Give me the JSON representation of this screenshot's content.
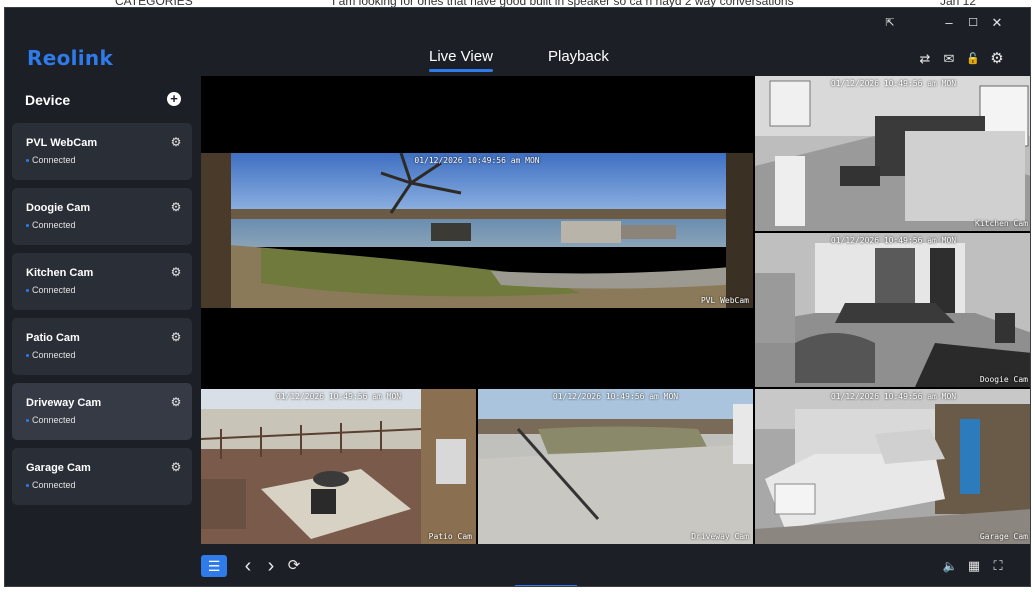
{
  "background_page": {
    "left_text": "CATEGORIES",
    "center_text": "I am looking for ones that have good built in speaker so ca n hayd 2 way conversations",
    "right_text": "Jan 12"
  },
  "app": {
    "logo": "Reolink",
    "accent_color": "#2f7bea"
  },
  "titlebar": {
    "pin_icon": "pin-window-icon",
    "minimize_icon": "minimize-icon",
    "maximize_icon": "maximize-icon",
    "close_icon": "close-icon",
    "pin_glyph": "⇱",
    "minimize_glyph": "–",
    "maximize_glyph": "☐",
    "close_glyph": "✕"
  },
  "nav": {
    "tabs": [
      {
        "label": "Live View",
        "active": true
      },
      {
        "label": "Playback",
        "active": false
      }
    ]
  },
  "header_icons": {
    "switch_glyph": "⇄",
    "message_glyph": "✉",
    "lock_glyph": "🔓",
    "settings_glyph": "⚙"
  },
  "sidebar": {
    "title": "Device",
    "add_glyph": "+",
    "devices": [
      {
        "name": "PVL WebCam",
        "status": "Connected"
      },
      {
        "name": "Doogie Cam",
        "status": "Connected"
      },
      {
        "name": "Kitchen Cam",
        "status": "Connected"
      },
      {
        "name": "Patio Cam",
        "status": "Connected"
      },
      {
        "name": "Driveway Cam",
        "status": "Connected",
        "selected": true
      },
      {
        "name": "Garage Cam",
        "status": "Connected"
      }
    ],
    "gear_glyph": "⚙"
  },
  "grid": {
    "tiles": [
      {
        "label": "PVL WebCam",
        "stamp": "01/12/2026 10:49:56 am MON"
      },
      {
        "label": "Kitchen Cam",
        "stamp": "01/12/2026 10:49:56 am MON"
      },
      {
        "label": "Doogie Cam",
        "stamp": "01/12/2026 10:49:56 am MON"
      },
      {
        "label": "Patio Cam",
        "stamp": "01/12/2026 10:49:56 am MON"
      },
      {
        "label": "Driveway Cam",
        "stamp": "01/12/2026 10:49:56 am MON"
      },
      {
        "label": "Garage Cam",
        "stamp": "01/12/2026 10:49:56 am MON"
      }
    ]
  },
  "bottombar": {
    "list_glyph": "☰",
    "prev_glyph": "‹",
    "next_glyph": "›",
    "refresh_glyph": "⟳",
    "volume_glyph": "🔈",
    "layout_glyph": "▦",
    "fullscreen_glyph": "⛶"
  }
}
